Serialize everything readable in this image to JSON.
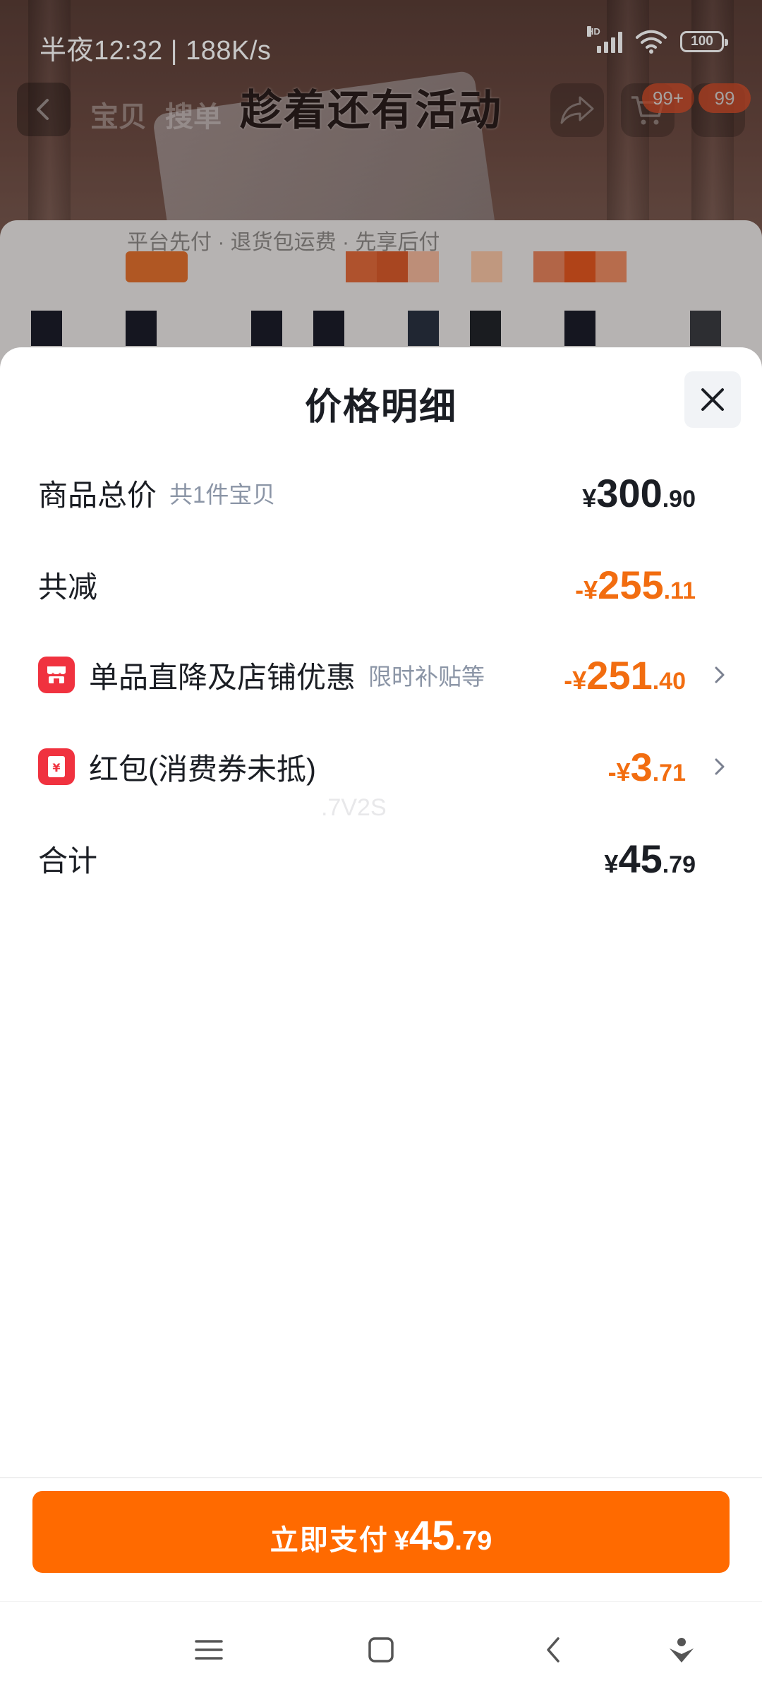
{
  "status_bar": {
    "time_speed": "半夜12:32 | 188K/s",
    "network": "HD",
    "battery": "100"
  },
  "background": {
    "tabs": [
      "宝贝",
      "搜单"
    ],
    "promo_title": "趁着还有活动",
    "cart_badge": "99+",
    "msg_badge": "99",
    "card_line": "平台先付 · 退货包运费 · 先享后付"
  },
  "sheet": {
    "title": "价格明细",
    "rows": [
      {
        "label": "商品总价",
        "sublabel": "共1件宝贝",
        "sign": "¥",
        "int": "300",
        "dec": ".90",
        "color": "#1b1e24"
      },
      {
        "label": "共减",
        "sign": "-¥",
        "int": "255",
        "dec": ".11",
        "color": "#f26d10"
      },
      {
        "label": "单品直降及店铺优惠",
        "sublabel": "限时补贴等",
        "icon": "store-icon",
        "sign": "-¥",
        "int": "251",
        "dec": ".40",
        "color": "#f26d10"
      },
      {
        "label": "红包(消费券未抵)",
        "icon": "red-packet-icon",
        "sign": "-¥",
        "int": "3",
        "dec": ".71",
        "color": "#f26d10"
      },
      {
        "label": "合计",
        "sign": "¥",
        "int": "45",
        "dec": ".79",
        "color": "#1b1e24"
      }
    ],
    "watermark": ".7V2S"
  },
  "pay": {
    "label": "立即支付",
    "sign": "¥",
    "int": "45",
    "dec": ".79",
    "color": "#ff6a00"
  },
  "system_nav": [
    "menu-icon",
    "home-icon",
    "back-icon",
    "assistant-icon"
  ]
}
